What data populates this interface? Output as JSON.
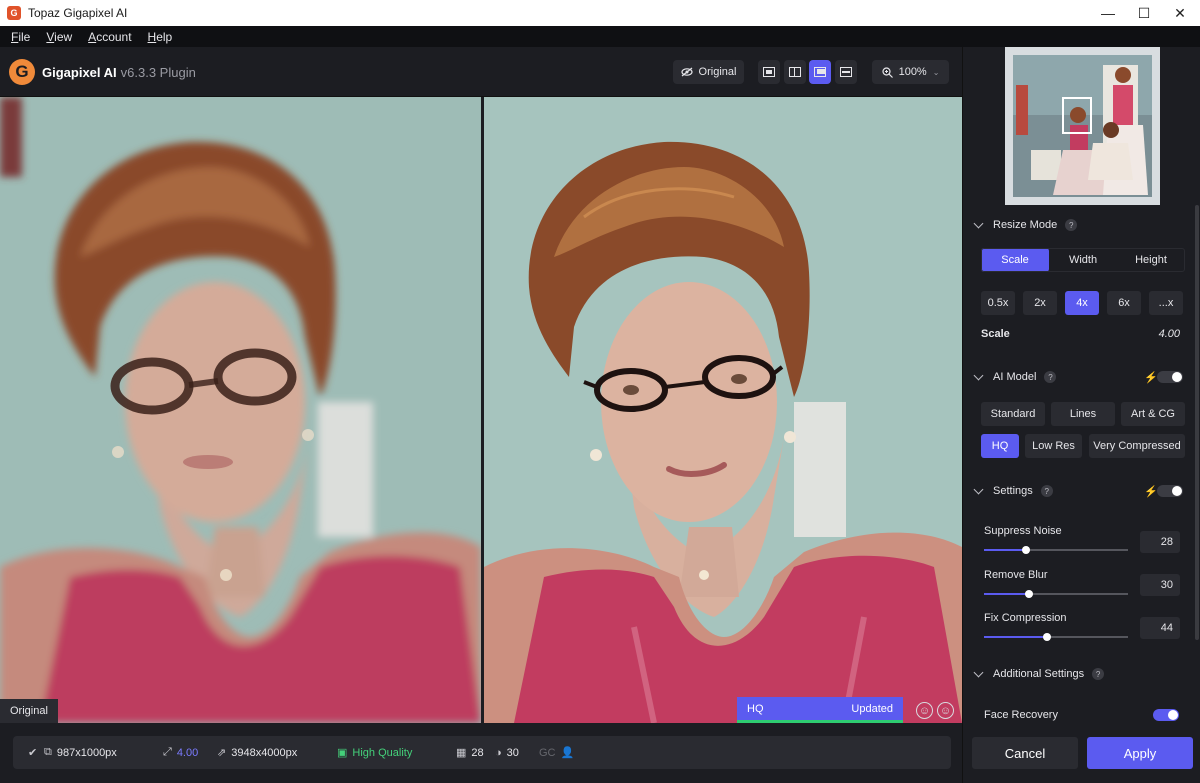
{
  "window": {
    "title": "Topaz Gigapixel AI",
    "icon": "topaz-g-icon",
    "controls": [
      "—",
      "☐",
      "✕"
    ]
  },
  "menu": [
    "File",
    "View",
    "Account",
    "Help"
  ],
  "toolbar": {
    "brand_name": "Gigapixel AI",
    "brand_version": "v6.3.3 Plugin",
    "original_label": "Original",
    "zoom_label": "100%",
    "view_modes": [
      "single-view",
      "split-view",
      "side-by-side-view",
      "comparison-grid-view"
    ],
    "active_view": "side-by-side-view"
  },
  "left_pane": {
    "label": "Original"
  },
  "right_pane": {
    "model_label": "HQ",
    "status_label": "Updated"
  },
  "status": {
    "source_size": "987x1000px",
    "scale": "4.00",
    "output_size": "3948x4000px",
    "quality": "High Quality",
    "noise_value": "28",
    "blur_value": "30",
    "gc_label": "GC"
  },
  "resize_mode": {
    "title": "Resize Mode",
    "modes": [
      "Scale",
      "Width",
      "Height"
    ],
    "active_mode": "Scale",
    "scales": [
      "0.5x",
      "2x",
      "4x",
      "6x",
      "...x"
    ],
    "active_scale": "4x",
    "scale_label": "Scale",
    "scale_value": "4.00"
  },
  "ai_model": {
    "title": "AI Model",
    "models_row1": [
      "Standard",
      "Lines",
      "Art & CG"
    ],
    "models_row2": [
      "HQ",
      "Low Res",
      "Very Compressed"
    ],
    "active_model": "HQ",
    "auto_toggle": false
  },
  "settings": {
    "title": "Settings",
    "auto_toggle": false,
    "suppress_noise": {
      "label": "Suppress Noise",
      "value": "28"
    },
    "remove_blur": {
      "label": "Remove Blur",
      "value": "30"
    },
    "fix_compression": {
      "label": "Fix Compression",
      "value": "44"
    }
  },
  "additional_settings": {
    "title": "Additional Settings",
    "face_recovery_label": "Face Recovery",
    "face_recovery_on": true
  },
  "actions": {
    "cancel": "Cancel",
    "apply": "Apply"
  },
  "colors": {
    "accent": "#5b5bf0",
    "brand_orange": "#f08a3a",
    "quality_green": "#44d07a"
  }
}
